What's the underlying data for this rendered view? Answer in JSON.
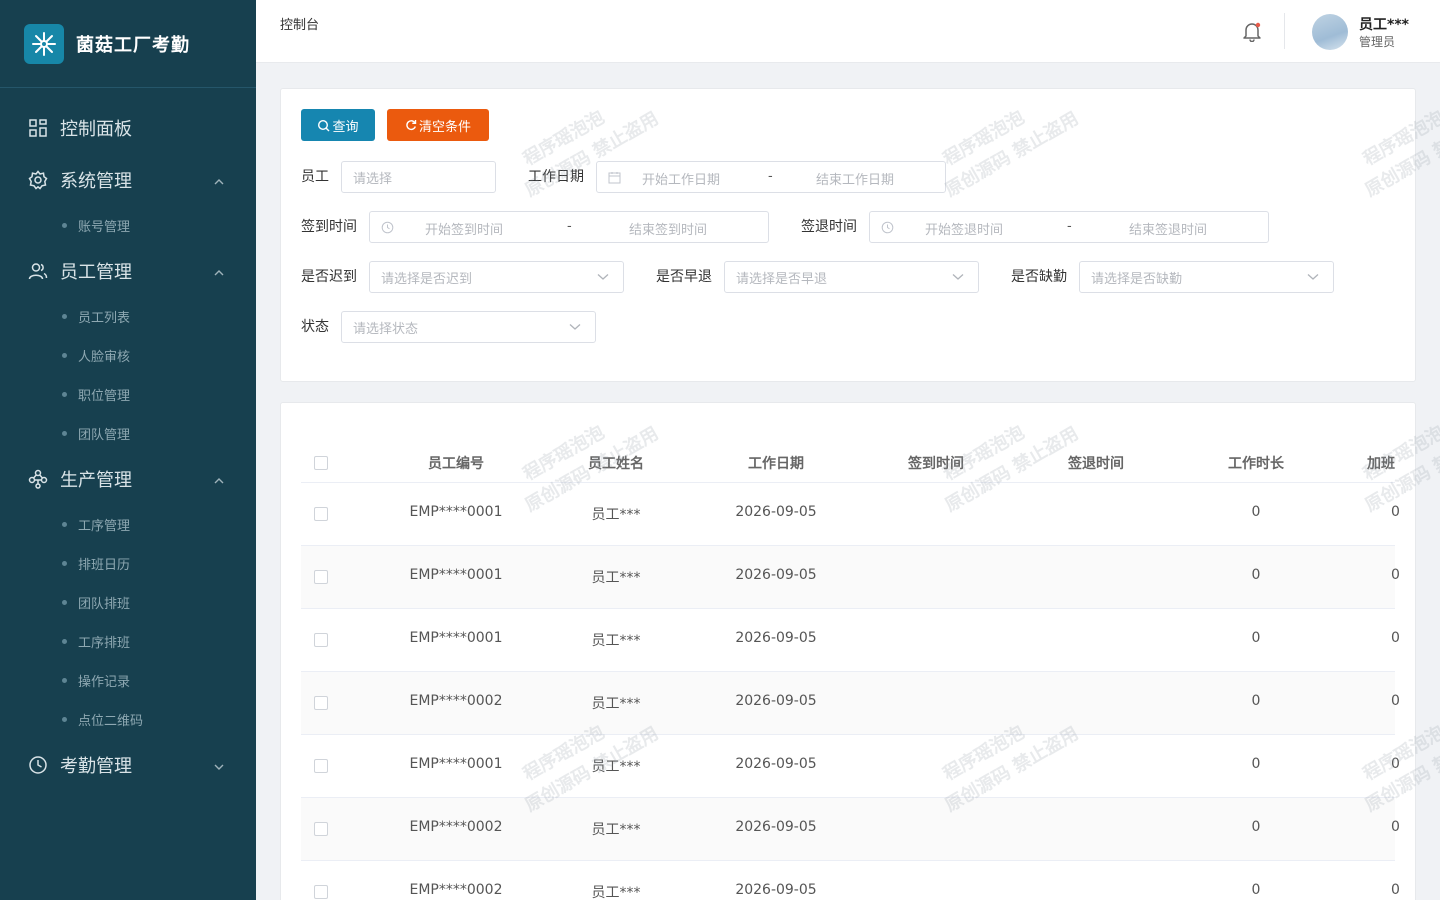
{
  "app": {
    "title": "菌菇工厂考勤"
  },
  "sidebar": {
    "menu": [
      {
        "label": "控制面板",
        "icon": "dashboard-icon",
        "expandable": false,
        "children": []
      },
      {
        "label": "系统管理",
        "icon": "gear-icon",
        "expandable": true,
        "expanded": true,
        "children": [
          "账号管理"
        ]
      },
      {
        "label": "员工管理",
        "icon": "users-icon",
        "expandable": true,
        "expanded": true,
        "children": [
          "员工列表",
          "人脸审核",
          "职位管理",
          "团队管理"
        ]
      },
      {
        "label": "生产管理",
        "icon": "network-icon",
        "expandable": true,
        "expanded": true,
        "children": [
          "工序管理",
          "排班日历",
          "团队排班",
          "工序排班",
          "操作记录",
          "点位二维码"
        ]
      },
      {
        "label": "考勤管理",
        "icon": "clock-icon",
        "expandable": true,
        "expanded": false,
        "children": []
      }
    ]
  },
  "header": {
    "breadcrumb": "控制台",
    "user": {
      "name": "员工***",
      "role": "管理员"
    }
  },
  "filters": {
    "query_label": "查询",
    "clear_label": "清空条件",
    "employee": {
      "label": "员工",
      "placeholder": "请选择"
    },
    "work_date": {
      "label": "工作日期",
      "start": "开始工作日期",
      "end": "结束工作日期",
      "sep": "-"
    },
    "checkin": {
      "label": "签到时间",
      "start": "开始签到时间",
      "end": "结束签到时间",
      "sep": "-"
    },
    "checkout": {
      "label": "签退时间",
      "start": "开始签退时间",
      "end": "结束签退时间",
      "sep": "-"
    },
    "late": {
      "label": "是否迟到",
      "placeholder": "请选择是否迟到"
    },
    "early": {
      "label": "是否早退",
      "placeholder": "请选择是否早退"
    },
    "absent": {
      "label": "是否缺勤",
      "placeholder": "请选择是否缺勤"
    },
    "status": {
      "label": "状态",
      "placeholder": "请选择状态"
    }
  },
  "table": {
    "columns": [
      "员工编号",
      "员工姓名",
      "工作日期",
      "签到时间",
      "签退时间",
      "工作时长",
      "加班"
    ],
    "rows": [
      {
        "emp_no": "EMP****0001",
        "name": "员工***",
        "date": "2026-09-05",
        "checkin": "",
        "checkout": "",
        "hours": "0",
        "overtime": "0"
      },
      {
        "emp_no": "EMP****0001",
        "name": "员工***",
        "date": "2026-09-05",
        "checkin": "",
        "checkout": "",
        "hours": "0",
        "overtime": "0"
      },
      {
        "emp_no": "EMP****0001",
        "name": "员工***",
        "date": "2026-09-05",
        "checkin": "",
        "checkout": "",
        "hours": "0",
        "overtime": "0"
      },
      {
        "emp_no": "EMP****0002",
        "name": "员工***",
        "date": "2026-09-05",
        "checkin": "",
        "checkout": "",
        "hours": "0",
        "overtime": "0"
      },
      {
        "emp_no": "EMP****0001",
        "name": "员工***",
        "date": "2026-09-05",
        "checkin": "",
        "checkout": "",
        "hours": "0",
        "overtime": "0"
      },
      {
        "emp_no": "EMP****0002",
        "name": "员工***",
        "date": "2026-09-05",
        "checkin": "",
        "checkout": "",
        "hours": "0",
        "overtime": "0"
      },
      {
        "emp_no": "EMP****0002",
        "name": "员工***",
        "date": "2026-09-05",
        "checkin": "",
        "checkout": "",
        "hours": "0",
        "overtime": "0"
      }
    ]
  },
  "watermark": {
    "line1": "程序瑶泡泡",
    "line2": "原创源码 禁止盗用"
  },
  "colors": {
    "sidebar": "#17404f",
    "primary": "#1686b0",
    "warning": "#eb5a0e"
  }
}
